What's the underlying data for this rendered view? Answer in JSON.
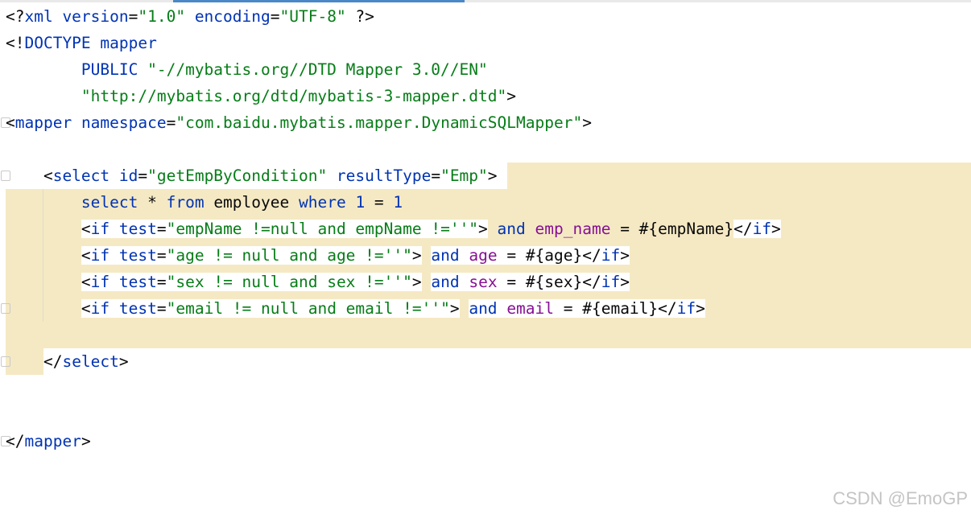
{
  "editor": {
    "lines": [
      [
        {
          "t": "<?",
          "c": "k"
        },
        {
          "t": "xml version",
          "c": "b"
        },
        {
          "t": "=",
          "c": "k"
        },
        {
          "t": "\"1.0\"",
          "c": "g"
        },
        {
          "t": " encoding",
          "c": "b"
        },
        {
          "t": "=",
          "c": "k"
        },
        {
          "t": "\"UTF-8\"",
          "c": "g"
        },
        {
          "t": " ?>",
          "c": "k"
        }
      ],
      [
        {
          "t": "<!",
          "c": "k"
        },
        {
          "t": "DOCTYPE mapper",
          "c": "b"
        }
      ],
      [
        {
          "t": "        PUBLIC ",
          "c": "b"
        },
        {
          "t": "\"-//mybatis.org//DTD Mapper 3.0//EN\"",
          "c": "g"
        }
      ],
      [
        {
          "t": "        \"http://mybatis.org/dtd/mybatis-3-mapper.dtd\"",
          "c": "g"
        },
        {
          "t": ">",
          "c": "k"
        }
      ],
      [
        {
          "t": "<",
          "c": "k"
        },
        {
          "t": "mapper ",
          "c": "b"
        },
        {
          "t": "namespace",
          "c": "b"
        },
        {
          "t": "=",
          "c": "k"
        },
        {
          "t": "\"com.baidu.mybatis.mapper.DynamicSQLMapper\"",
          "c": "g"
        },
        {
          "t": ">",
          "c": "k"
        }
      ],
      [],
      [
        {
          "t": "    <",
          "c": "k"
        },
        {
          "t": "select ",
          "c": "b"
        },
        {
          "t": "id",
          "c": "b"
        },
        {
          "t": "=",
          "c": "k"
        },
        {
          "t": "\"getEmpByCondition\"",
          "c": "g"
        },
        {
          "t": " resultType",
          "c": "b"
        },
        {
          "t": "=",
          "c": "k"
        },
        {
          "t": "\"Emp\"",
          "c": "g"
        },
        {
          "t": ">",
          "c": "k"
        }
      ],
      [
        {
          "t": "        ",
          "c": "k"
        },
        {
          "t": "select",
          "c": "b"
        },
        {
          "t": " * ",
          "c": "k"
        },
        {
          "t": "from",
          "c": "b"
        },
        {
          "t": " employee ",
          "c": "k"
        },
        {
          "t": "where",
          "c": "b"
        },
        {
          "t": " ",
          "c": "k"
        },
        {
          "t": "1",
          "c": "b"
        },
        {
          "t": " = ",
          "c": "k"
        },
        {
          "t": "1",
          "c": "b"
        }
      ],
      [
        {
          "t": "        ",
          "c": "k"
        },
        {
          "t": "<",
          "c": "k",
          "w": 1
        },
        {
          "t": "if ",
          "c": "b",
          "w": 1
        },
        {
          "t": "test",
          "c": "b",
          "w": 1
        },
        {
          "t": "=",
          "c": "k",
          "w": 1
        },
        {
          "t": "\"empName !=null and empName !=''\"",
          "c": "g",
          "w": 1
        },
        {
          "t": ">",
          "c": "k",
          "w": 1
        },
        {
          "t": " ",
          "c": "k"
        },
        {
          "t": "and",
          "c": "b"
        },
        {
          "t": " ",
          "c": "k"
        },
        {
          "t": "emp_name",
          "c": "p"
        },
        {
          "t": " = #{empName}",
          "c": "k"
        },
        {
          "t": "</",
          "c": "k",
          "w": 1
        },
        {
          "t": "if",
          "c": "b",
          "w": 1
        },
        {
          "t": ">",
          "c": "k",
          "w": 1
        }
      ],
      [
        {
          "t": "        ",
          "c": "k"
        },
        {
          "t": "<",
          "c": "k",
          "w": 1
        },
        {
          "t": "if ",
          "c": "b",
          "w": 1
        },
        {
          "t": "test",
          "c": "b",
          "w": 1
        },
        {
          "t": "=",
          "c": "k",
          "w": 1
        },
        {
          "t": "\"age != null and age !=''\"",
          "c": "g",
          "w": 1
        },
        {
          "t": ">",
          "c": "k",
          "w": 1
        },
        {
          "t": " ",
          "c": "k"
        },
        {
          "t": "and",
          "c": "b",
          "w": 1
        },
        {
          "t": " ",
          "c": "k",
          "w": 1
        },
        {
          "t": "age",
          "c": "p",
          "w": 1
        },
        {
          "t": " = #{age}",
          "c": "k",
          "w": 1
        },
        {
          "t": "</",
          "c": "k",
          "w": 1
        },
        {
          "t": "if",
          "c": "b",
          "w": 1
        },
        {
          "t": ">",
          "c": "k",
          "w": 1
        }
      ],
      [
        {
          "t": "        ",
          "c": "k"
        },
        {
          "t": "<",
          "c": "k",
          "w": 1
        },
        {
          "t": "if ",
          "c": "b",
          "w": 1
        },
        {
          "t": "test",
          "c": "b",
          "w": 1
        },
        {
          "t": "=",
          "c": "k",
          "w": 1
        },
        {
          "t": "\"sex != null and sex !=''\"",
          "c": "g",
          "w": 1
        },
        {
          "t": ">",
          "c": "k",
          "w": 1
        },
        {
          "t": " ",
          "c": "k"
        },
        {
          "t": "and",
          "c": "b",
          "w": 1
        },
        {
          "t": " ",
          "c": "k",
          "w": 1
        },
        {
          "t": "sex",
          "c": "p",
          "w": 1
        },
        {
          "t": " = #{sex}",
          "c": "k",
          "w": 1
        },
        {
          "t": "</",
          "c": "k",
          "w": 1
        },
        {
          "t": "if",
          "c": "b",
          "w": 1
        },
        {
          "t": ">",
          "c": "k",
          "w": 1
        }
      ],
      [
        {
          "t": "        ",
          "c": "k"
        },
        {
          "t": "<",
          "c": "k",
          "w": 1
        },
        {
          "t": "if ",
          "c": "b",
          "w": 1
        },
        {
          "t": "test",
          "c": "b",
          "w": 1
        },
        {
          "t": "=",
          "c": "k",
          "w": 1
        },
        {
          "t": "\"email != null and email !=''\"",
          "c": "g",
          "w": 1
        },
        {
          "t": ">",
          "c": "k",
          "w": 1
        },
        {
          "t": " ",
          "c": "k"
        },
        {
          "t": "and",
          "c": "b",
          "w": 1
        },
        {
          "t": " ",
          "c": "k",
          "w": 1
        },
        {
          "t": "email",
          "c": "p",
          "w": 1
        },
        {
          "t": " = #{email}",
          "c": "k",
          "w": 1
        },
        {
          "t": "</",
          "c": "k",
          "w": 1
        },
        {
          "t": "if",
          "c": "b",
          "w": 1
        },
        {
          "t": ">",
          "c": "k",
          "w": 1
        }
      ],
      [],
      [
        {
          "t": "    </",
          "c": "k"
        },
        {
          "t": "select",
          "c": "b"
        },
        {
          "t": ">",
          "c": "k"
        }
      ],
      [],
      [],
      [
        {
          "t": "</",
          "c": "k"
        },
        {
          "t": "mapper",
          "c": "b"
        },
        {
          "t": ">",
          "c": "k"
        }
      ]
    ],
    "fold_lines": [
      4,
      6,
      11,
      13,
      16
    ]
  },
  "watermark": "CSDN @EmoGP"
}
